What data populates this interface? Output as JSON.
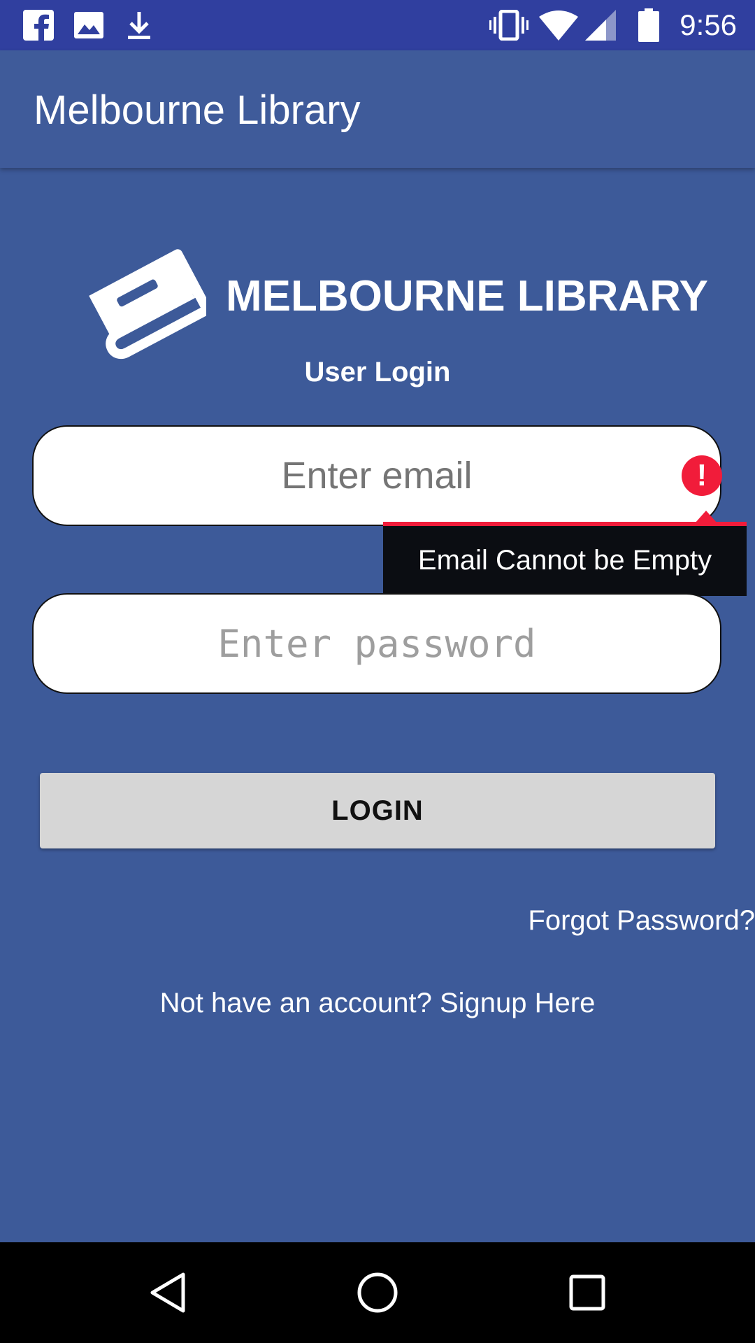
{
  "status_bar": {
    "time": "9:56",
    "left_icons": [
      "facebook-icon",
      "image-icon",
      "download-icon"
    ],
    "right_icons": [
      "vibrate-icon",
      "wifi-icon",
      "signal-icon",
      "battery-icon"
    ],
    "background": "#303F9F"
  },
  "app_bar": {
    "title": "Melbourne Library",
    "background": "#3F5B9A"
  },
  "header": {
    "logo_icon": "book-icon",
    "brand": "MELBOURNE LIBRARY",
    "subtitle": "User Login"
  },
  "form": {
    "email": {
      "value": "",
      "placeholder": "Enter email"
    },
    "password": {
      "value": "",
      "placeholder": "Enter password"
    },
    "error": {
      "icon": "error-icon",
      "message": "Email Cannot be Empty",
      "color": "#F11C3A"
    },
    "login_label": "LOGIN"
  },
  "links": {
    "forgot_password": "Forgot Password?",
    "signup": "Not have an account? Signup Here"
  },
  "nav_bar": {
    "buttons": [
      "back-icon",
      "home-icon",
      "recents-icon"
    ]
  },
  "colors": {
    "background": "#3D5A99",
    "button": "#D6D6D6"
  }
}
